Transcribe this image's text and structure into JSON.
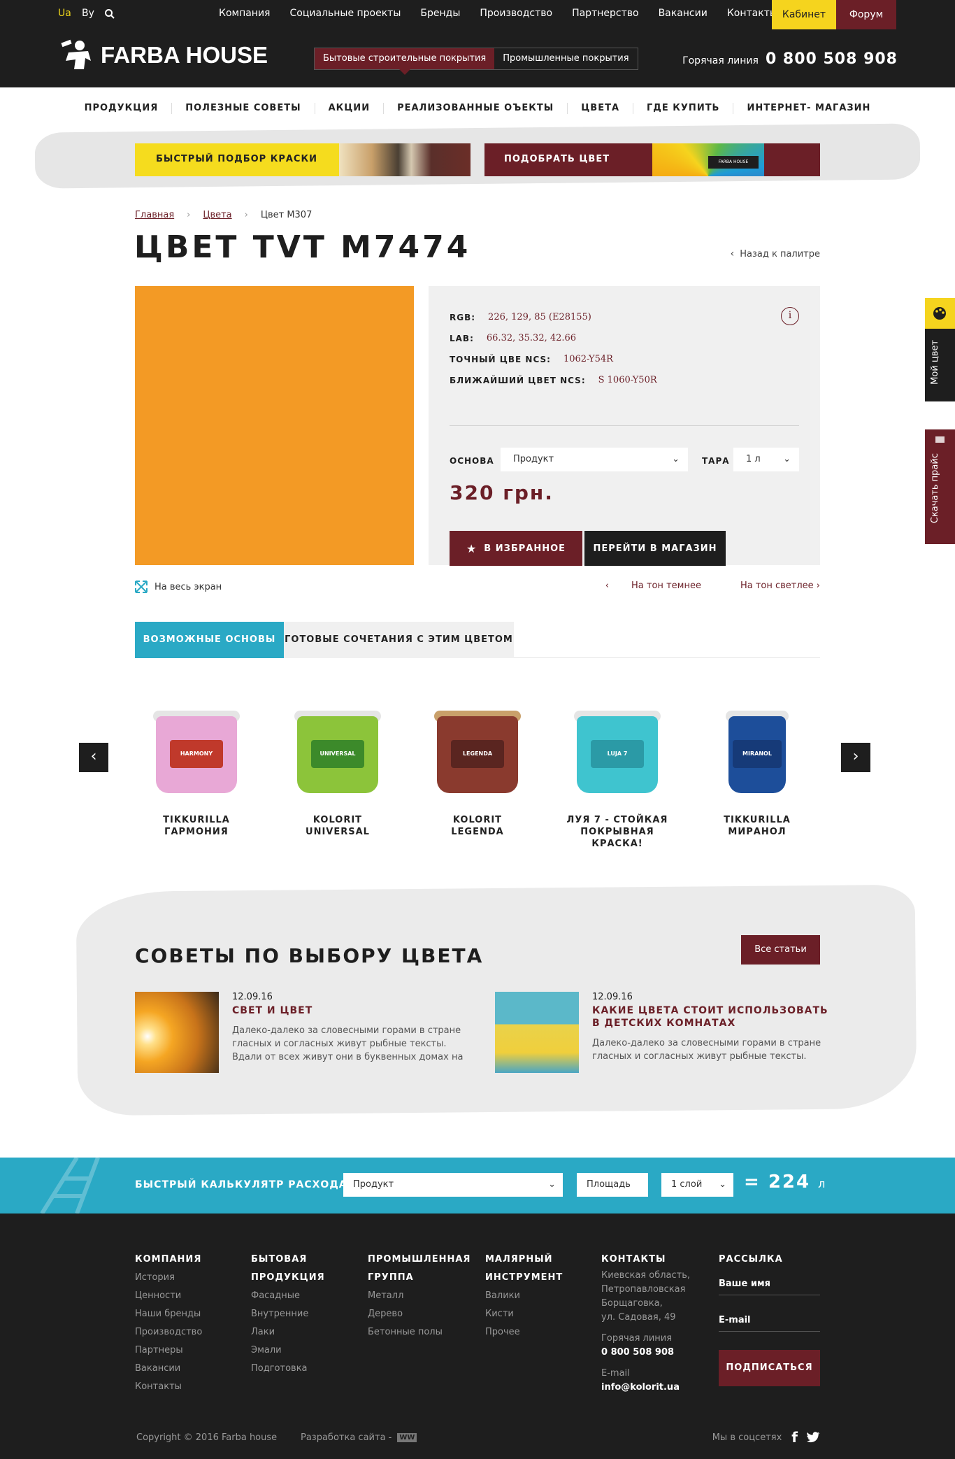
{
  "header": {
    "lang_ua": "Ua",
    "lang_by": "By",
    "nav": [
      "Компания",
      "Социальные проекты",
      "Бренды",
      "Производство",
      "Партнерство",
      "Вакансии",
      "Контакты"
    ],
    "cabinet": "Кабинет",
    "forum": "Форум",
    "logo": "FARBA HOUSE",
    "segment_active": "Бытовые строительные покрытия",
    "segment_other": "Промышленные покрытия",
    "hotline_label": "Горячая линия",
    "hotline_number": "0 800 508 908"
  },
  "main_nav": [
    "ПРОДУКЦИЯ",
    "ПОЛЕЗНЫЕ СОВЕТЫ",
    "АКЦИИ",
    "РЕАЛИЗОВАННЫЕ ОЪЕКТЫ",
    "ЦВЕТА",
    "ГДЕ КУПИТЬ",
    "ИНТЕРНЕТ- МАГАЗИН"
  ],
  "promo": {
    "paint_pick": "БЫСТРЫЙ ПОДБОР КРАСКИ",
    "color_pick": "ПОДОБРАТЬ ЦВЕТ",
    "fan_logo": "FARBA HOUSE"
  },
  "breadcrumb": {
    "home": "Главная",
    "colors": "Цвета",
    "current": "Цвет М307"
  },
  "page_title": "ЦВЕТ TVT M7474",
  "back_to_palette": "Назад к палитре",
  "color": {
    "swatch_hex": "#F39A25",
    "rgb_label": "RGB:",
    "rgb": "226, 129, 85 (E28155)",
    "lab_label": "LAB:",
    "lab": "66.32, 35.32, 42.66",
    "ncs_exact_label": "ТОЧНЫЙ ЦВЕ NCS:",
    "ncs_exact": "1062-Y54R",
    "ncs_near_label": "БЛИЖАЙШИЙ ЦВЕТ NCS:",
    "ncs_near": "S 1060-Y50R",
    "base_label": "ОСНОВА",
    "base_value": "Продукт",
    "tara_label": "ТАРА",
    "tara_value": "1 л",
    "price": "320 грн.",
    "fav_btn": "В ИЗБРАННОЕ",
    "shop_btn": "ПЕРЕЙТИ В МАГАЗИН",
    "fullscreen": "На весь экран",
    "darker": "На тон темнее",
    "lighter": "На тон светлее"
  },
  "tabs": [
    "ВОЗМОЖНЫЕ ОСНОВЫ",
    "ГОТОВЫЕ СОЧЕТАНИЯ С ЭТИМ ЦВЕТОМ"
  ],
  "products": [
    {
      "name": "TIKKURILLA ГАРМОНИЯ",
      "label": "HARMONY",
      "color": "#e8a8d6"
    },
    {
      "name": "KOLORIT UNIVERSAL",
      "label": "UNIVERSAL",
      "color": "#8cc43a"
    },
    {
      "name": "KOLORIT LEGENDA",
      "label": "LEGENDA",
      "color": "#8a3a2e"
    },
    {
      "name": "ЛУЯ 7 - СТОЙКАЯ ПОКРЫВНАЯ КРАСКА!",
      "label": "LUJA 7",
      "color": "#3fc4cf"
    },
    {
      "name": "TIKKURILLA МИРАНОЛ",
      "label": "MIRANOL",
      "color": "#1d4e9a"
    }
  ],
  "tips": {
    "title": "СОВЕТЫ ПО ВЫБОРУ ЦВЕТА",
    "all_btn": "Все статьи",
    "articles": [
      {
        "date": "12.09.16",
        "title": "СВЕТ И ЦВЕТ",
        "text": "Далеко-далеко за словесными горами в стране гласных и согласных живут рыбные тексты. Вдали от всех живут они в буквенных домах на"
      },
      {
        "date": "12.09.16",
        "title": "КАКИЕ ЦВЕТА СТОИТ ИСПОЛЬЗОВАТЬ В ДЕТСКИХ КОМНАТАХ",
        "text": "Далеко-далеко за словесными горами в стране гласных и согласных живут рыбные тексты."
      }
    ]
  },
  "calc": {
    "title": "БЫСТРЫЙ КАЛЬКУЛЯТР РАСХОДА",
    "product": "Продукт",
    "area": "Площадь",
    "layers": "1 слой",
    "result": "= 224",
    "unit": "л"
  },
  "footer": {
    "col1": {
      "title": "КОМПАНИЯ",
      "items": [
        "История",
        "Ценности",
        "Наши бренды",
        "Производство",
        "Партнеры",
        "Вакансии",
        "Контакты"
      ]
    },
    "col2": {
      "title1": "БЫТОВАЯ",
      "title2": "ПРОДУКЦИЯ",
      "items": [
        "Фасадные",
        "Внутренние",
        "Лаки",
        "Эмали",
        "Подготовка"
      ]
    },
    "col3": {
      "title1": "ПРОМЫШЛЕННАЯ",
      "title2": "ГРУППА",
      "items": [
        "Металл",
        "Дерево",
        "Бетонные полы"
      ]
    },
    "col4": {
      "title1": "МАЛЯРНЫЙ",
      "title2": "ИНСТРУМЕНТ",
      "items": [
        "Валики",
        "Кисти",
        "Прочее"
      ]
    },
    "contacts": {
      "title": "КОНТАКТЫ",
      "addr1": "Киевская область,",
      "addr2": "Петропавловская",
      "addr3": "Борщаговка,",
      "addr4": "ул. Садовая, 49",
      "hot_label": "Горячая линия",
      "hot": "0 800 508 908",
      "email_label": "E-mail",
      "email": "info@kolorit.ua"
    },
    "subscribe": {
      "title": "РАССЫЛКА",
      "name_ph": "Ваше имя",
      "email_ph": "E-mail",
      "btn": "ПОДПИСАТЬСЯ"
    },
    "copyright": "Copyright © 2016 Farba house",
    "dev": "Разработка сайта -",
    "dev_logo": "WW",
    "social": "Мы в соцсетях"
  },
  "side": {
    "my_color": "Мой цвет",
    "price": "Скачать прайс"
  }
}
